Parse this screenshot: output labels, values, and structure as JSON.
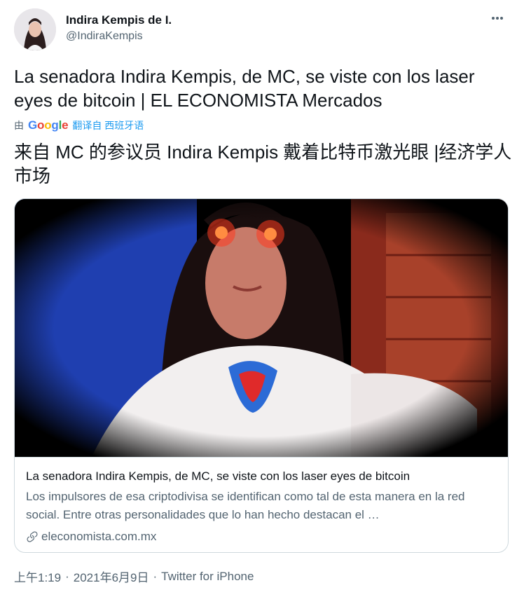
{
  "author": {
    "display_name": "Indira Kempis de I.",
    "handle": "@IndiraKempis"
  },
  "tweet": {
    "text": "La senadora Indira Kempis, de MC, se viste con los laser eyes de bitcoin | EL ECONOMISTA Mercados"
  },
  "translation": {
    "by_label": "由",
    "google_letters": [
      "G",
      "o",
      "o",
      "g",
      "l",
      "e"
    ],
    "link_label": "翻译自 西班牙语",
    "text": "来自 MC 的参议员 Indira Kempis 戴着比特币激光眼 |经济学人市场"
  },
  "card": {
    "title": "La senadora Indira Kempis, de MC, se viste con los laser eyes de bitcoin",
    "description": "Los impulsores de esa criptodivisa se identifican como tal de esta manera en la red social. Entre otras personalidades que lo han hecho destacan el …",
    "domain": "eleconomista.com.mx"
  },
  "meta": {
    "time": "上午1:19",
    "separator": "·",
    "date": "2021年6月9日",
    "separator2": "·",
    "source": "Twitter for iPhone"
  },
  "icons": {
    "more": "more-horizontal-icon",
    "link": "link-icon"
  },
  "colors": {
    "link_blue": "#1d9bf0",
    "secondary_text": "#536471",
    "border": "#cfd9de"
  }
}
